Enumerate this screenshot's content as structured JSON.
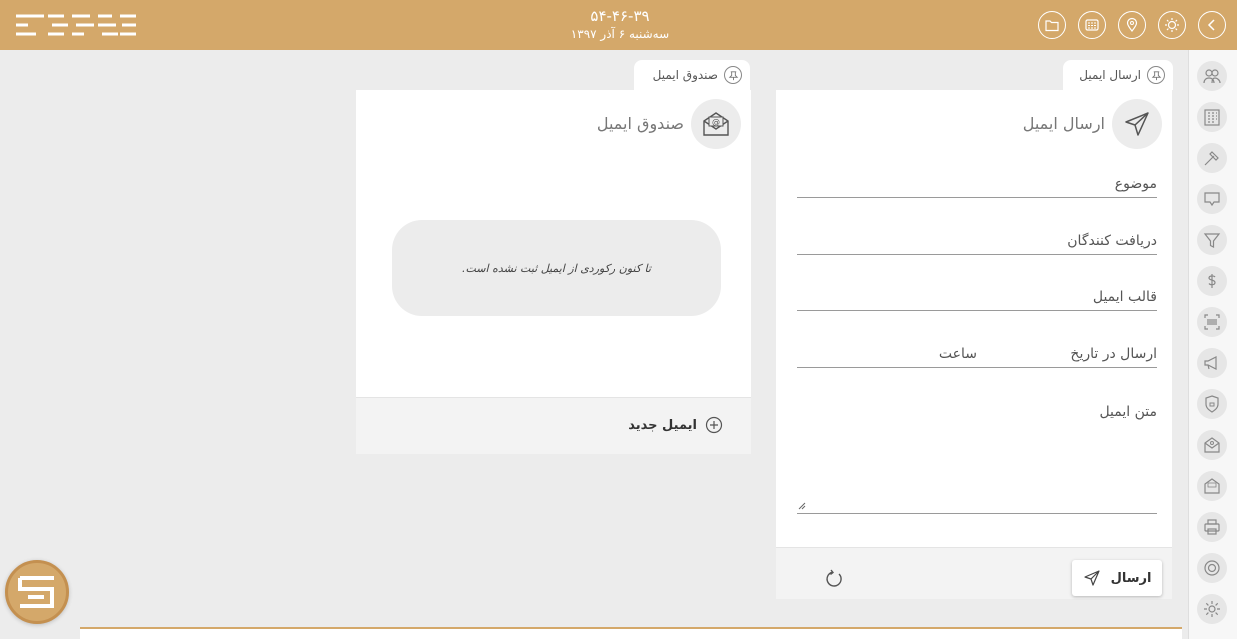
{
  "header": {
    "time": "۵۴-۴۶-۳۹",
    "date": "سه‌شنبه ۶ آذر ۱۳۹۷",
    "icons": [
      "chevron-left-icon",
      "sun-icon",
      "location-pin-icon",
      "calendar-grid-icon",
      "folder-icon"
    ]
  },
  "sidebar": {
    "icons": [
      "users-icon",
      "building-icon",
      "hammer-icon",
      "message-icon",
      "filter-icon",
      "dollar-icon",
      "barcode-icon",
      "megaphone-icon",
      "lock-shield-icon",
      "email-at-icon",
      "sms-icon",
      "printer-icon",
      "lifebuoy-icon",
      "gear-icon"
    ]
  },
  "send_email": {
    "tab_label": "ارسال ایمیل",
    "title": "ارسال ایمیل",
    "fields": {
      "subject": "موضوع",
      "recipients": "دریافت کنندگان",
      "template": "قالب ایمیل",
      "send_date": "ارسال در تاریخ",
      "send_time": "ساعت",
      "body": "متن ایمیل"
    },
    "send_button": "ارسال"
  },
  "inbox": {
    "tab_label": "صندوق ایمیل",
    "title": "صندوق ایمیل",
    "empty_message": "تا کنون رکوردی از ایمیل ثبت نشده است.",
    "new_email_label": "ایمیل جدید"
  },
  "colors": {
    "accent": "#d4a86a",
    "background": "#ececec"
  }
}
